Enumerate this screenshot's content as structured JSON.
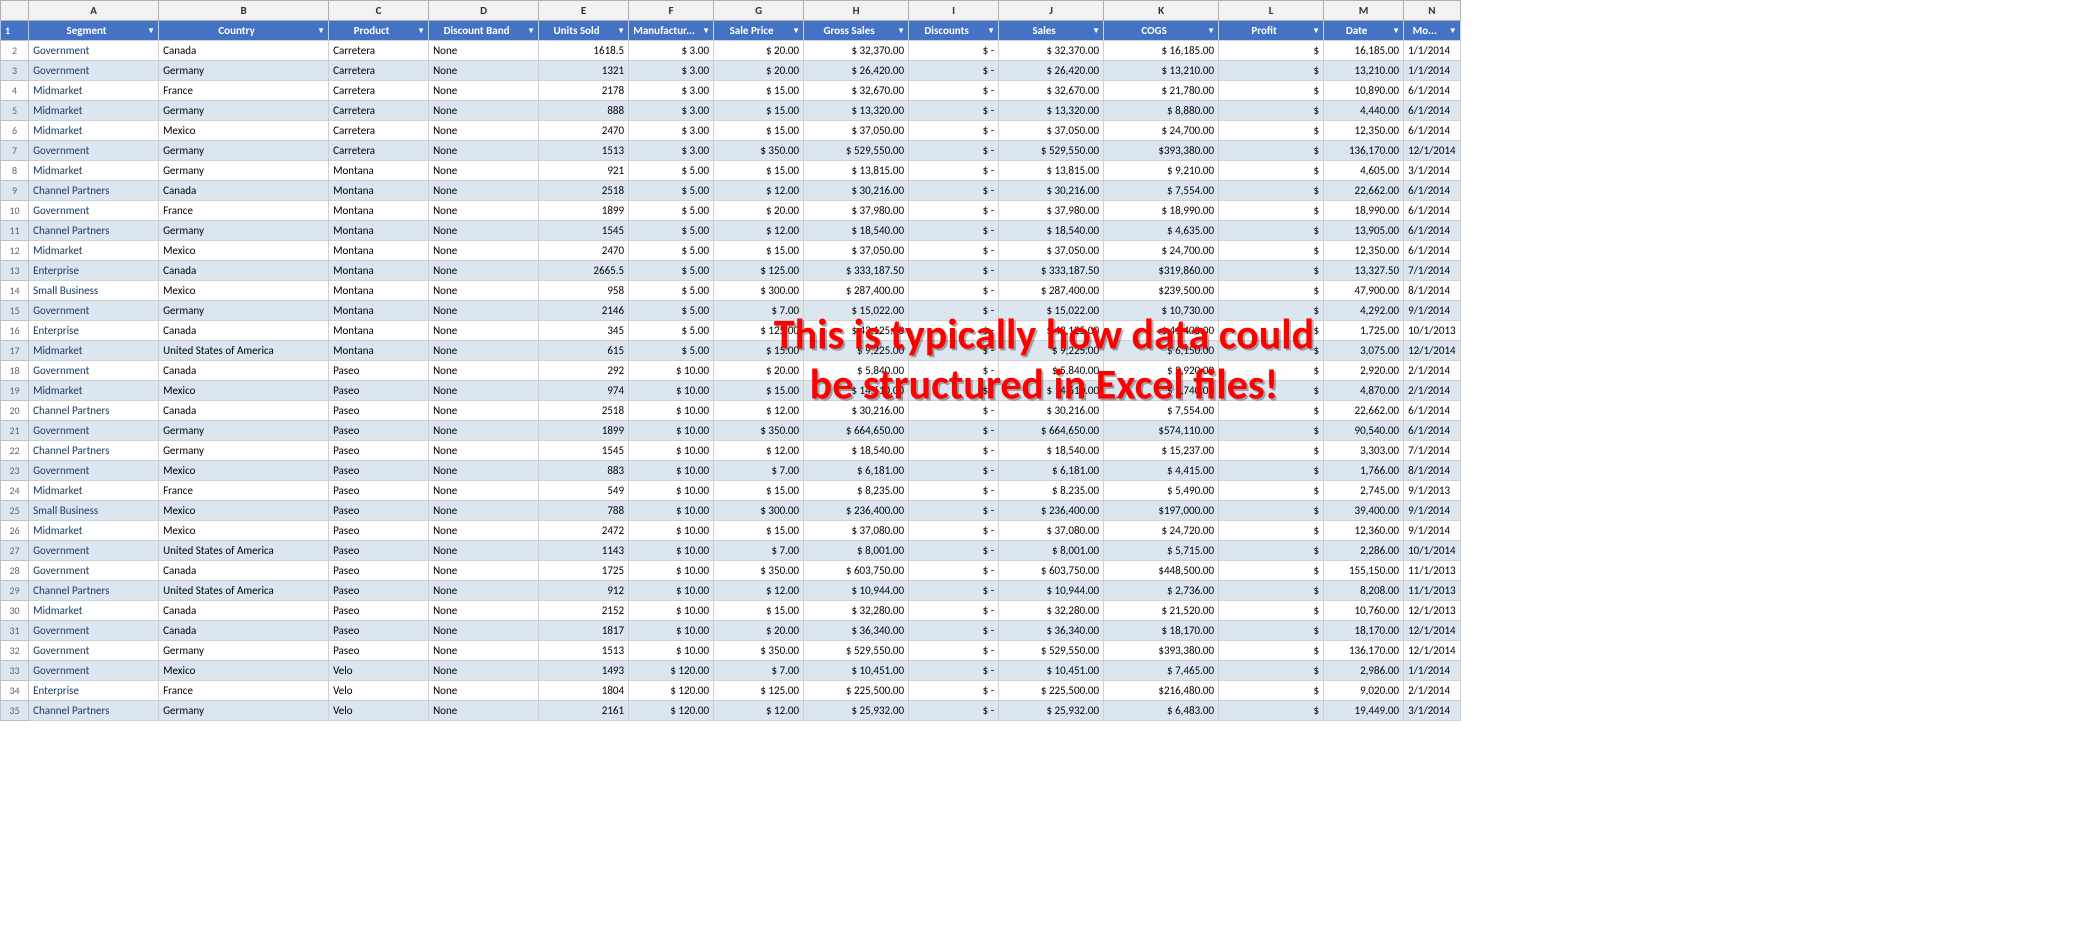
{
  "columns": {
    "letters": [
      "",
      "A",
      "B",
      "C",
      "D",
      "E",
      "F",
      "G",
      "H",
      "I",
      "J",
      "K",
      "L",
      "M",
      "N"
    ],
    "headers": [
      "Segment",
      "Country",
      "Product",
      "Discount Band",
      "Units Sold",
      "Manufacturing Price",
      "Sale Price",
      "Gross Sales",
      "Discounts",
      "Sales",
      "COGS",
      "Profit",
      "Date",
      "Mo..."
    ]
  },
  "overlay": {
    "line1": "This is typically how data could",
    "line2": "be structured in Excel files!"
  },
  "rows": [
    [
      "Government",
      "Canada",
      "Carretera",
      "None",
      "1618.5",
      "$ 3.00",
      "$ 20.00",
      "$ 32,370.00",
      "$  -",
      "$ 32,370.00",
      "$ 16,185.00",
      "$",
      "16,185.00",
      "1/1/2014"
    ],
    [
      "Government",
      "Germany",
      "Carretera",
      "None",
      "1321",
      "$ 3.00",
      "$ 20.00",
      "$ 26,420.00",
      "$  -",
      "$ 26,420.00",
      "$ 13,210.00",
      "$",
      "13,210.00",
      "1/1/2014"
    ],
    [
      "Midmarket",
      "France",
      "Carretera",
      "None",
      "2178",
      "$ 3.00",
      "$ 15.00",
      "$ 32,670.00",
      "$  -",
      "$ 32,670.00",
      "$ 21,780.00",
      "$",
      "10,890.00",
      "6/1/2014"
    ],
    [
      "Midmarket",
      "Germany",
      "Carretera",
      "None",
      "888",
      "$ 3.00",
      "$ 15.00",
      "$ 13,320.00",
      "$  -",
      "$ 13,320.00",
      "$ 8,880.00",
      "$",
      "4,440.00",
      "6/1/2014"
    ],
    [
      "Midmarket",
      "Mexico",
      "Carretera",
      "None",
      "2470",
      "$ 3.00",
      "$ 15.00",
      "$ 37,050.00",
      "$  -",
      "$ 37,050.00",
      "$ 24,700.00",
      "$",
      "12,350.00",
      "6/1/2014"
    ],
    [
      "Government",
      "Germany",
      "Carretera",
      "None",
      "1513",
      "$ 3.00",
      "$ 350.00",
      "$ 529,550.00",
      "$  -",
      "$ 529,550.00",
      "$393,380.00",
      "$",
      "136,170.00",
      "12/1/2014"
    ],
    [
      "Midmarket",
      "Germany",
      "Montana",
      "None",
      "921",
      "$ 5.00",
      "$ 15.00",
      "$ 13,815.00",
      "$  -",
      "$ 13,815.00",
      "$ 9,210.00",
      "$",
      "4,605.00",
      "3/1/2014"
    ],
    [
      "Channel Partners",
      "Canada",
      "Montana",
      "None",
      "2518",
      "$ 5.00",
      "$ 12.00",
      "$ 30,216.00",
      "$  -",
      "$ 30,216.00",
      "$ 7,554.00",
      "$",
      "22,662.00",
      "6/1/2014"
    ],
    [
      "Government",
      "France",
      "Montana",
      "None",
      "1899",
      "$ 5.00",
      "$ 20.00",
      "$ 37,980.00",
      "$  -",
      "$ 37,980.00",
      "$ 18,990.00",
      "$",
      "18,990.00",
      "6/1/2014"
    ],
    [
      "Channel Partners",
      "Germany",
      "Montana",
      "None",
      "1545",
      "$ 5.00",
      "$ 12.00",
      "$ 18,540.00",
      "$  -",
      "$ 18,540.00",
      "$ 4,635.00",
      "$",
      "13,905.00",
      "6/1/2014"
    ],
    [
      "Midmarket",
      "Mexico",
      "Montana",
      "None",
      "2470",
      "$ 5.00",
      "$ 15.00",
      "$ 37,050.00",
      "$  -",
      "$ 37,050.00",
      "$ 24,700.00",
      "$",
      "12,350.00",
      "6/1/2014"
    ],
    [
      "Enterprise",
      "Canada",
      "Montana",
      "None",
      "2665.5",
      "$ 5.00",
      "$ 125.00",
      "$ 333,187.50",
      "$  -",
      "$ 333,187.50",
      "$319,860.00",
      "$",
      "13,327.50",
      "7/1/2014"
    ],
    [
      "Small Business",
      "Mexico",
      "Montana",
      "None",
      "958",
      "$ 5.00",
      "$ 300.00",
      "$ 287,400.00",
      "$  -",
      "$ 287,400.00",
      "$239,500.00",
      "$",
      "47,900.00",
      "8/1/2014"
    ],
    [
      "Government",
      "Germany",
      "Montana",
      "None",
      "2146",
      "$ 5.00",
      "$ 7.00",
      "$ 15,022.00",
      "$  -",
      "$ 15,022.00",
      "$ 10,730.00",
      "$",
      "4,292.00",
      "9/1/2014"
    ],
    [
      "Enterprise",
      "Canada",
      "Montana",
      "None",
      "345",
      "$ 5.00",
      "$ 125.00",
      "$ 43,125.00",
      "$  -",
      "$ 43,125.00",
      "$ 41,400.00",
      "$",
      "1,725.00",
      "10/1/2013"
    ],
    [
      "Midmarket",
      "United States of America",
      "Montana",
      "None",
      "615",
      "$ 5.00",
      "$ 15.00",
      "$ 9,225.00",
      "$  -",
      "$ 9,225.00",
      "$ 6,150.00",
      "$",
      "3,075.00",
      "12/1/2014"
    ],
    [
      "Government",
      "Canada",
      "Paseo",
      "None",
      "292",
      "$ 10.00",
      "$ 20.00",
      "$ 5,840.00",
      "$  -",
      "$ 5,840.00",
      "$ 2,920.00",
      "$",
      "2,920.00",
      "2/1/2014"
    ],
    [
      "Midmarket",
      "Mexico",
      "Paseo",
      "None",
      "974",
      "$ 10.00",
      "$ 15.00",
      "$ 14,610.00",
      "$  -",
      "$ 14,610.00",
      "$ 9,740.00",
      "$",
      "4,870.00",
      "2/1/2014"
    ],
    [
      "Channel Partners",
      "Canada",
      "Paseo",
      "None",
      "2518",
      "$ 10.00",
      "$ 12.00",
      "$ 30,216.00",
      "$  -",
      "$ 30,216.00",
      "$ 7,554.00",
      "$",
      "22,662.00",
      "6/1/2014"
    ],
    [
      "Government",
      "Germany",
      "Paseo",
      "None",
      "1899",
      "$ 10.00",
      "$ 350.00",
      "$ 664,650.00",
      "$  -",
      "$ 664,650.00",
      "$574,110.00",
      "$",
      "90,540.00",
      "6/1/2014"
    ],
    [
      "Channel Partners",
      "Germany",
      "Paseo",
      "None",
      "1545",
      "$ 10.00",
      "$ 12.00",
      "$ 18,540.00",
      "$  -",
      "$ 18,540.00",
      "$ 15,237.00",
      "$",
      "3,303.00",
      "7/1/2014"
    ],
    [
      "Government",
      "Mexico",
      "Paseo",
      "None",
      "883",
      "$ 10.00",
      "$ 7.00",
      "$ 6,181.00",
      "$  -",
      "$ 6,181.00",
      "$ 4,415.00",
      "$",
      "1,766.00",
      "8/1/2014"
    ],
    [
      "Midmarket",
      "France",
      "Paseo",
      "None",
      "549",
      "$ 10.00",
      "$ 15.00",
      "$ 8,235.00",
      "$  -",
      "$ 8,235.00",
      "$ 5,490.00",
      "$",
      "2,745.00",
      "9/1/2013"
    ],
    [
      "Small Business",
      "Mexico",
      "Paseo",
      "None",
      "788",
      "$ 10.00",
      "$ 300.00",
      "$ 236,400.00",
      "$  -",
      "$ 236,400.00",
      "$197,000.00",
      "$",
      "39,400.00",
      "9/1/2014"
    ],
    [
      "Midmarket",
      "Mexico",
      "Paseo",
      "None",
      "2472",
      "$ 10.00",
      "$ 15.00",
      "$ 37,080.00",
      "$  -",
      "$ 37,080.00",
      "$ 24,720.00",
      "$",
      "12,360.00",
      "9/1/2014"
    ],
    [
      "Government",
      "United States of America",
      "Paseo",
      "None",
      "1143",
      "$ 10.00",
      "$ 7.00",
      "$ 8,001.00",
      "$  -",
      "$ 8,001.00",
      "$ 5,715.00",
      "$",
      "2,286.00",
      "10/1/2014"
    ],
    [
      "Government",
      "Canada",
      "Paseo",
      "None",
      "1725",
      "$ 10.00",
      "$ 350.00",
      "$ 603,750.00",
      "$  -",
      "$ 603,750.00",
      "$448,500.00",
      "$",
      "155,150.00",
      "11/1/2013"
    ],
    [
      "Channel Partners",
      "United States of America",
      "Paseo",
      "None",
      "912",
      "$ 10.00",
      "$ 12.00",
      "$ 10,944.00",
      "$  -",
      "$ 10,944.00",
      "$ 2,736.00",
      "$",
      "8,208.00",
      "11/1/2013"
    ],
    [
      "Midmarket",
      "Canada",
      "Paseo",
      "None",
      "2152",
      "$ 10.00",
      "$ 15.00",
      "$ 32,280.00",
      "$  -",
      "$ 32,280.00",
      "$ 21,520.00",
      "$",
      "10,760.00",
      "12/1/2013"
    ],
    [
      "Government",
      "Canada",
      "Paseo",
      "None",
      "1817",
      "$ 10.00",
      "$ 20.00",
      "$ 36,340.00",
      "$  -",
      "$ 36,340.00",
      "$ 18,170.00",
      "$",
      "18,170.00",
      "12/1/2014"
    ],
    [
      "Government",
      "Germany",
      "Paseo",
      "None",
      "1513",
      "$ 10.00",
      "$ 350.00",
      "$ 529,550.00",
      "$  -",
      "$ 529,550.00",
      "$393,380.00",
      "$",
      "136,170.00",
      "12/1/2014"
    ],
    [
      "Government",
      "Mexico",
      "Velo",
      "None",
      "1493",
      "$ 120.00",
      "$ 7.00",
      "$ 10,451.00",
      "$  -",
      "$ 10,451.00",
      "$ 7,465.00",
      "$",
      "2,986.00",
      "1/1/2014"
    ],
    [
      "Enterprise",
      "France",
      "Velo",
      "None",
      "1804",
      "$ 120.00",
      "$ 125.00",
      "$ 225,500.00",
      "$  -",
      "$ 225,500.00",
      "$216,480.00",
      "$",
      "9,020.00",
      "2/1/2014"
    ],
    [
      "Channel Partners",
      "Germany",
      "Velo",
      "None",
      "2161",
      "$ 120.00",
      "$ 12.00",
      "$ 25,932.00",
      "$  -",
      "$ 25,932.00",
      "$ 6,483.00",
      "$",
      "19,449.00",
      "3/1/2014"
    ]
  ]
}
